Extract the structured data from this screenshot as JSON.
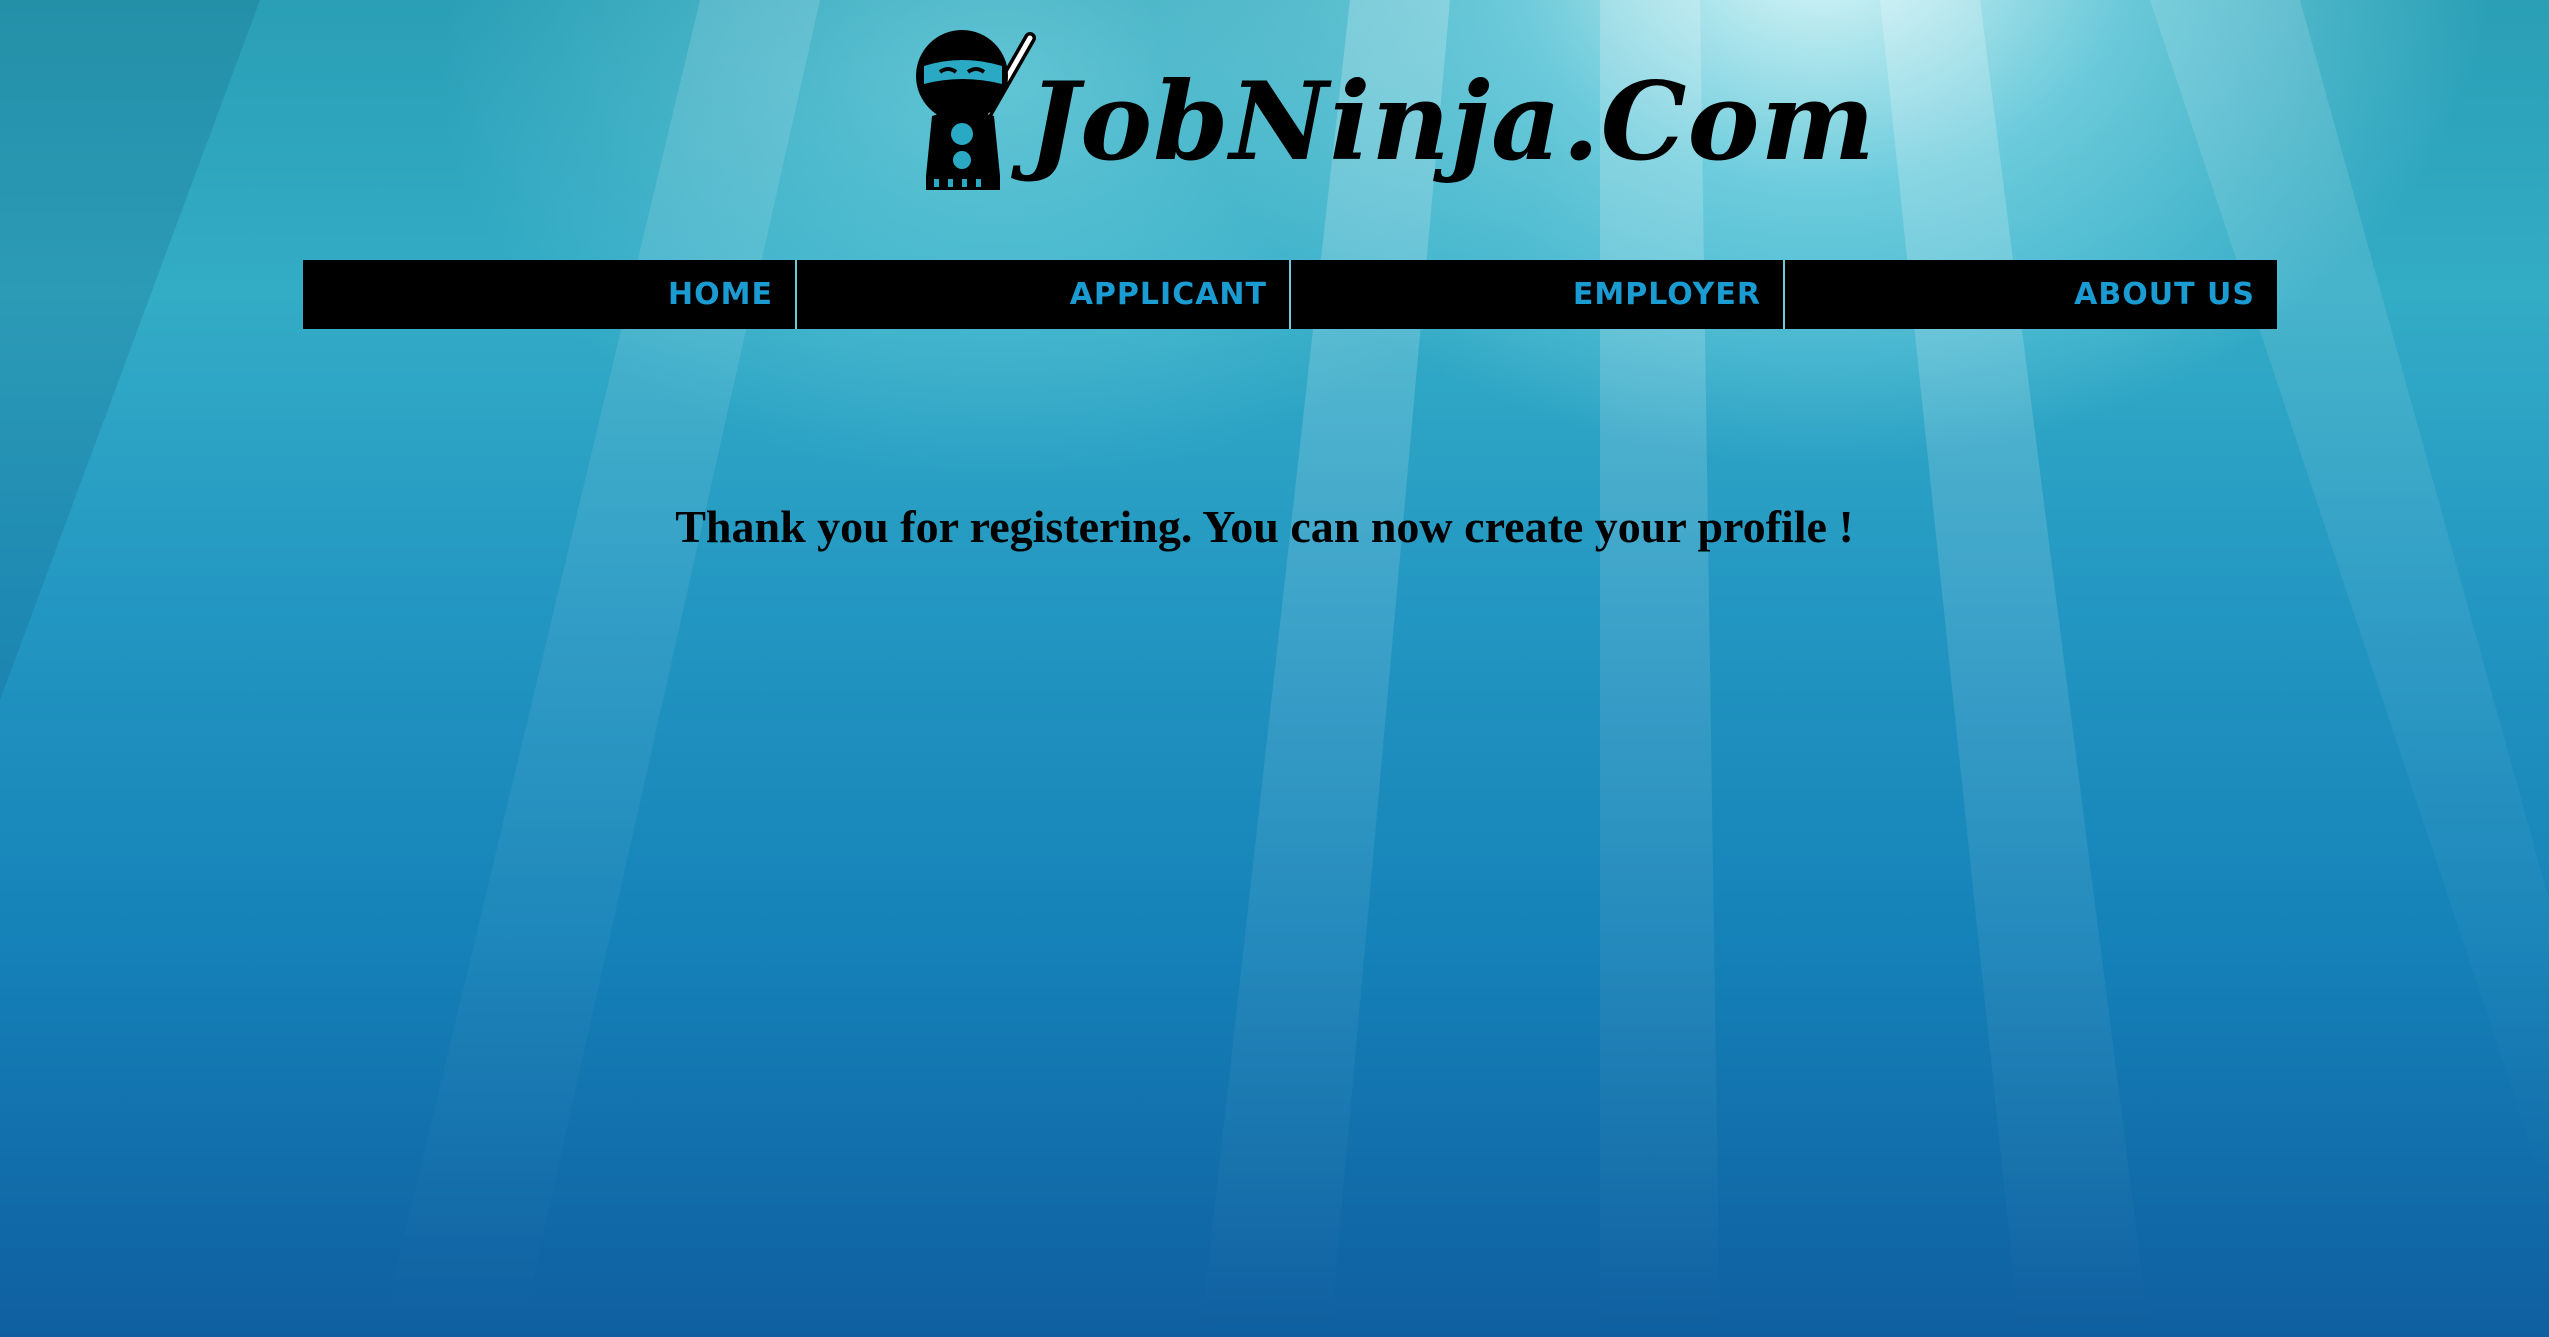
{
  "brand": {
    "name": "JobNinja.Com",
    "logo_icon": "ninja-icon"
  },
  "nav": {
    "items": [
      {
        "label": "HOME"
      },
      {
        "label": "APPLICANT"
      },
      {
        "label": "EMPLOYER"
      },
      {
        "label": "ABOUT US"
      }
    ]
  },
  "main": {
    "message": "Thank you for registering. You can now create your profile !"
  },
  "colors": {
    "nav_background": "#000000",
    "nav_text": "#1a9cd3",
    "nav_divider": "#6fc7d8",
    "message_text": "#000000"
  }
}
